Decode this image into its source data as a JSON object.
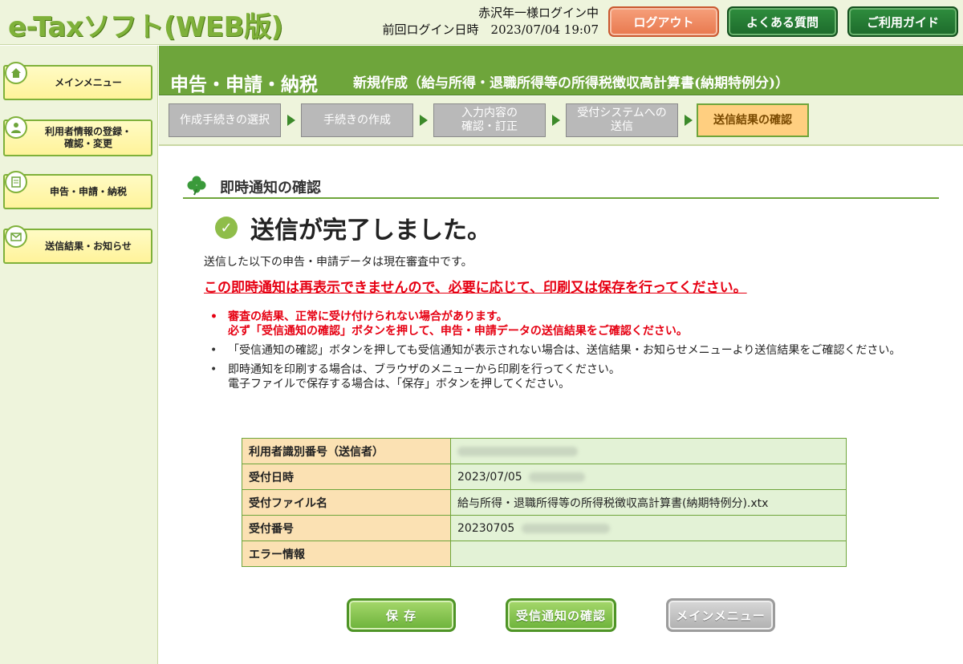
{
  "header": {
    "logo": "e-Taxソフト(WEB版)",
    "login_user": "赤沢年一様ログイン中",
    "last_login": "前回ログイン日時　2023/07/04 19:07",
    "logout_label": "ログアウト",
    "faq_label": "よくある質問",
    "guide_label": "ご利用ガイド"
  },
  "sidebar": {
    "items": [
      {
        "label": "メインメニュー",
        "icon": "home-icon"
      },
      {
        "label": "利用者情報の登録・\n確認・変更",
        "icon": "user-icon"
      },
      {
        "label": "申告・申請・納税",
        "icon": "document-icon"
      },
      {
        "label": "送信結果・お知らせ",
        "icon": "mail-icon"
      }
    ]
  },
  "title": {
    "main": "申告・申請・納税",
    "sub": "新規作成（給与所得・退職所得等の所得税徴収高計算書(納期特例分)）"
  },
  "steps": [
    {
      "label": "作成手続きの選択",
      "active": false
    },
    {
      "label": "手続きの作成",
      "active": false
    },
    {
      "label": "入力内容の\n確認・訂正",
      "active": false
    },
    {
      "label": "受付システムへの\n送信",
      "active": false
    },
    {
      "label": "送信結果の確認",
      "active": true
    }
  ],
  "content": {
    "section_title": "即時通知の確認",
    "done_message": "送信が完了しました。",
    "note": "送信した以下の申告・申請データは現在審査中です。",
    "warning": "この即時通知は再表示できませんので、必要に応じて、印刷又は保存を行ってください。",
    "bullets": [
      {
        "text": "審査の結果、正常に受け付けられない場合があります。\n必ず「受信通知の確認」ボタンを押して、申告・申請データの送信結果をご確認ください。",
        "emphasis": true
      },
      {
        "text": "「受信通知の確認」ボタンを押しても受信通知が表示されない場合は、送信結果・お知らせメニューより送信結果をご確認ください。",
        "emphasis": false
      },
      {
        "text": "即時通知を印刷する場合は、ブラウザのメニューから印刷を行ってください。\n電子ファイルで保存する場合は、「保存」ボタンを押してください。",
        "emphasis": false
      }
    ]
  },
  "table": {
    "rows": [
      {
        "key": "利用者識別番号（送信者）",
        "value": ""
      },
      {
        "key": "受付日時",
        "value": "2023/07/05"
      },
      {
        "key": "受付ファイル名",
        "value": "給与所得・退職所得等の所得税徴収高計算書(納期特例分).xtx"
      },
      {
        "key": "受付番号",
        "value": "20230705"
      },
      {
        "key": "エラー情報",
        "value": ""
      }
    ]
  },
  "buttons": {
    "save": "保 存",
    "check_receipt": "受信通知の確認",
    "main_menu": "メインメニュー"
  },
  "colors": {
    "brand_green": "#6ea53b",
    "warning_red": "#e60012",
    "logout_orange": "#e8784e"
  }
}
